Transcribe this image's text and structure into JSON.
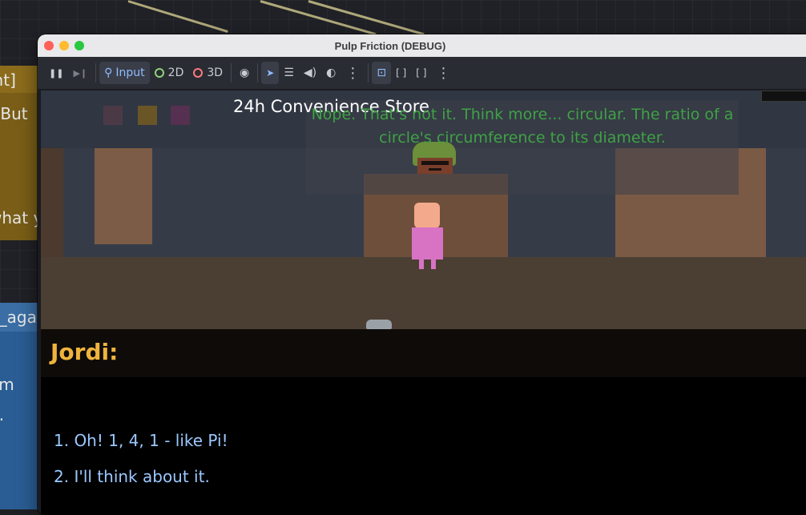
{
  "window": {
    "title": "Pulp Friction (DEBUG)"
  },
  "toolbar": {
    "items": [
      {
        "name": "pause-button",
        "icon": "pause-icon",
        "glyph": "❚❚"
      },
      {
        "name": "step-frame-button",
        "icon": "step-forward-icon",
        "glyph": "▶❙"
      },
      {
        "name": "input-mode-button",
        "icon": "input-icon",
        "label": "Input"
      },
      {
        "name": "mode-2d-button",
        "icon": "circle-2d-icon",
        "label": "2D"
      },
      {
        "name": "mode-3d-button",
        "icon": "circle-3d-icon",
        "label": "3D"
      },
      {
        "name": "visibility-button",
        "icon": "eye-icon",
        "glyph": "◉"
      },
      {
        "name": "select-button",
        "icon": "pointer-icon",
        "glyph": "➤"
      },
      {
        "name": "list-select-button",
        "icon": "list-select-icon",
        "glyph": "☰"
      },
      {
        "name": "audio-button",
        "icon": "speaker-icon",
        "glyph": "🔊"
      },
      {
        "name": "camera-button",
        "icon": "camera-icon",
        "glyph": "◐"
      },
      {
        "name": "more-options-button-1",
        "icon": "more-vertical-icon",
        "glyph": "⋮"
      },
      {
        "name": "camera-override-button",
        "icon": "camera-override-icon",
        "glyph": "⊡"
      },
      {
        "name": "fullscreen-button",
        "icon": "fullscreen-icon",
        "glyph": "⛶"
      },
      {
        "name": "expand-button",
        "icon": "expand-icon",
        "glyph": "⤢"
      },
      {
        "name": "more-options-button-2",
        "icon": "more-vertical-icon",
        "glyph": "⋮"
      }
    ]
  },
  "colors": {
    "input_active": "#8fbcff",
    "ring_2d": "#8fd27a",
    "ring_3d": "#ff7a7a",
    "hint_green": "#3fa244",
    "speaker_gold": "#f0b43c",
    "choice_blue": "#9bc8ff"
  },
  "background_editor": {
    "yellow_node": {
      "header": "int]",
      "line1": "! But",
      "line2": "what y"
    },
    "blue_node": {
      "header": "n_aga",
      "line1": "em",
      "line2": "..."
    }
  },
  "game": {
    "location": "24h Convenience Store",
    "hint": "Nope. That's not it. Think more... circular. The ratio of a circle's circumference to its diameter.",
    "dialogue": {
      "speaker": "Jordi:",
      "choices": [
        "1. Oh! 1, 4, 1 - like Pi!",
        "2. I'll think about it."
      ]
    }
  }
}
